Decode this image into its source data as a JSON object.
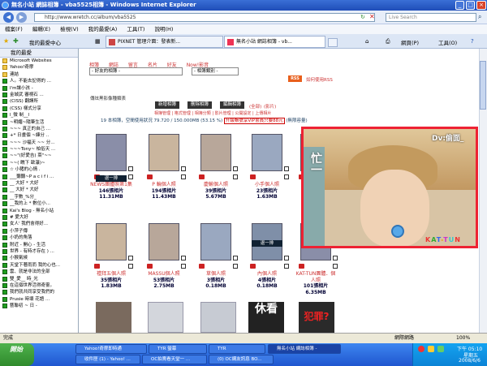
{
  "window": {
    "title": "無名小站 網誌相簿 - vba5525相簿 - Windows Internet Explorer"
  },
  "address": {
    "url": "http://www.wretch.cc/album/vba5525",
    "search_placeholder": "Live Search"
  },
  "menu": [
    "檔案(F)",
    "編輯(E)",
    "檢視(V)",
    "我的最愛(A)",
    "工具(T)",
    "說明(H)"
  ],
  "favbar": {
    "label": "我的最愛",
    "center": "我的最愛中心"
  },
  "tabs": [
    {
      "label": "PIXNET 管理介面：發表新..."
    },
    {
      "label": "無名小站 網誌相簿 - vb..."
    }
  ],
  "toolbar_right": {
    "page": "網頁(P)",
    "tools": "工具(O)"
  },
  "sidebar": {
    "header": "我的最愛",
    "items": [
      "Microsoft Websites",
      "Yahoo!奇摩",
      "連結",
      "人。不能去記得的 ...",
      "I'm讓小孩 -",
      "金城武 審視石 ...",
      "(CISS) 翻譯所",
      "(CSS) 樣式分享",
      "l_微 制__l",
      "~明媚~隨筆生活",
      "~~~ 真正的自己 ...",
      "+* 日畫個 ~練分 ..",
      "~~~ 沙福天 ~~ 分...",
      "~~~Tony~ 柏俗天 ...",
      "~~\"(好愛吉) 菜\"~~",
      "~~( 瞧下 歐瀑)~",
      "☆ 小猪的心情 .",
      "___聽聽~P a c i f i ...",
      "__ 大好 * 大好",
      "__ 大好 * 大好",
      "__字數_%分_",
      "__我的上 * 數位小...",
      "Kai's Blog - 無名小站",
      "# 愛大好",
      "女人' 我們會得好...",
      "小萍子傳",
      "小奶的角落",
      "附近 - 開心 - 生活",
      "世界 - 有時才存在 ) ...",
      "小猴氣候",
      "天堂下著雨而 我的心也...",
      "雲、就是非法的全部",
      "雙_愛__ 時_光",
      "在這個世界活得奇靈。",
      "我們就共同享受我們的",
      "Prusie 時壤 花語 ...",
      "藝聯初 ~ 日 -"
    ]
  },
  "page": {
    "nav": [
      "相簿",
      "網誌",
      "留言",
      "名片",
      "好友",
      "Now!影音"
    ],
    "select1": "- 好友的相簿 -",
    "select2": "- 相簿類別 -",
    "rss": "RSS",
    "rss_link": "如何使用RSS",
    "caption": "傳炫黑影像種類表",
    "buttons": [
      "新增相簿",
      "刪除相簿",
      "編輯相簿"
    ],
    "links": [
      "(全部)",
      "(影片)"
    ],
    "sublinks": "相簿管理 | 格式管理 | 相簿分類 | 影片管理 | 公開設定 | 上傳相片",
    "stats_prefix": "19 本相簿，空間使用狀況 79.720 / 150.000MB (53.15 %)",
    "stats_link": "升級帳號享VIP會員只要88元",
    "stats_suffix": "(無限容量)",
    "albums": [
      {
        "name": "NEWS團體照第1集",
        "count": "146張相片",
        "size": "11.31MB"
      },
      {
        "name": "P 輪個人照",
        "count": "194張相片",
        "size": "11.43MB"
      },
      {
        "name": "慶輸個人照",
        "count": "39張相片",
        "size": "5.67MB"
      },
      {
        "name": "小手個人照",
        "count": "23張相片",
        "size": "1.63MB"
      },
      {
        "name": "小山個人照",
        "count": "14張相片",
        "size": ""
      },
      {
        "name": "禮拜五個人照",
        "count": "35張相片",
        "size": "1.83MB"
      },
      {
        "name": "MASSU個人照",
        "count": "53張相片",
        "size": "2.75MB"
      },
      {
        "name": "草個人照",
        "count": "3張相片",
        "size": "0.18MB"
      },
      {
        "name": "內個人照",
        "count": "4張相片",
        "size": "0.18MB"
      },
      {
        "name": "KAT-TUN團體．個人照",
        "count": "101張相片",
        "size": "6.35MB"
      }
    ],
    "exit_label": "退一排",
    "video_overlay": {
      "watermark": "Dv:偷面_",
      "kat": "KAT-TUN",
      "side": "忙一"
    }
  },
  "status": {
    "left": "完成",
    "zone": "網際網路",
    "zoom": "100%"
  },
  "taskbar": {
    "start": "開始",
    "row1": [
      "Yahoo!奇摩即時通",
      "TYR 螢幕",
      "TYR",
      "無名小站 網誌相簿 -"
    ],
    "row2": [
      "收件匣 (1) - Yahoo! ...",
      "OC拍賣看天堂一 ...",
      "(0) OC網友訊息 BO..."
    ],
    "clock": "下午 05:10",
    "day": "星期五",
    "date": "2008/6/6"
  }
}
